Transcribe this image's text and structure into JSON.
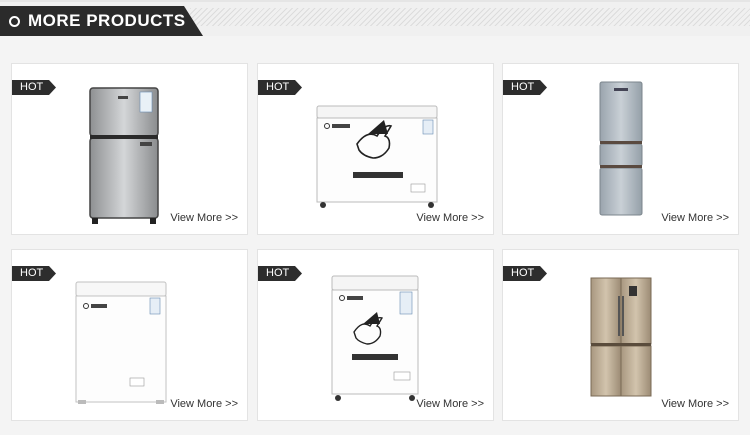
{
  "section": {
    "title": "MORE PRODUCTS"
  },
  "products": [
    {
      "badge": "HOT",
      "more_label": "View More >>",
      "kind": "double-door-fridge"
    },
    {
      "badge": "HOT",
      "more_label": "View More >>",
      "kind": "chest-freezer-large"
    },
    {
      "badge": "HOT",
      "more_label": "View More >>",
      "kind": "three-door-fridge"
    },
    {
      "badge": "HOT",
      "more_label": "View More >>",
      "kind": "chest-freezer-small"
    },
    {
      "badge": "HOT",
      "more_label": "View More >>",
      "kind": "chest-freezer-medium"
    },
    {
      "badge": "HOT",
      "more_label": "View More >>",
      "kind": "four-door-fridge"
    }
  ]
}
